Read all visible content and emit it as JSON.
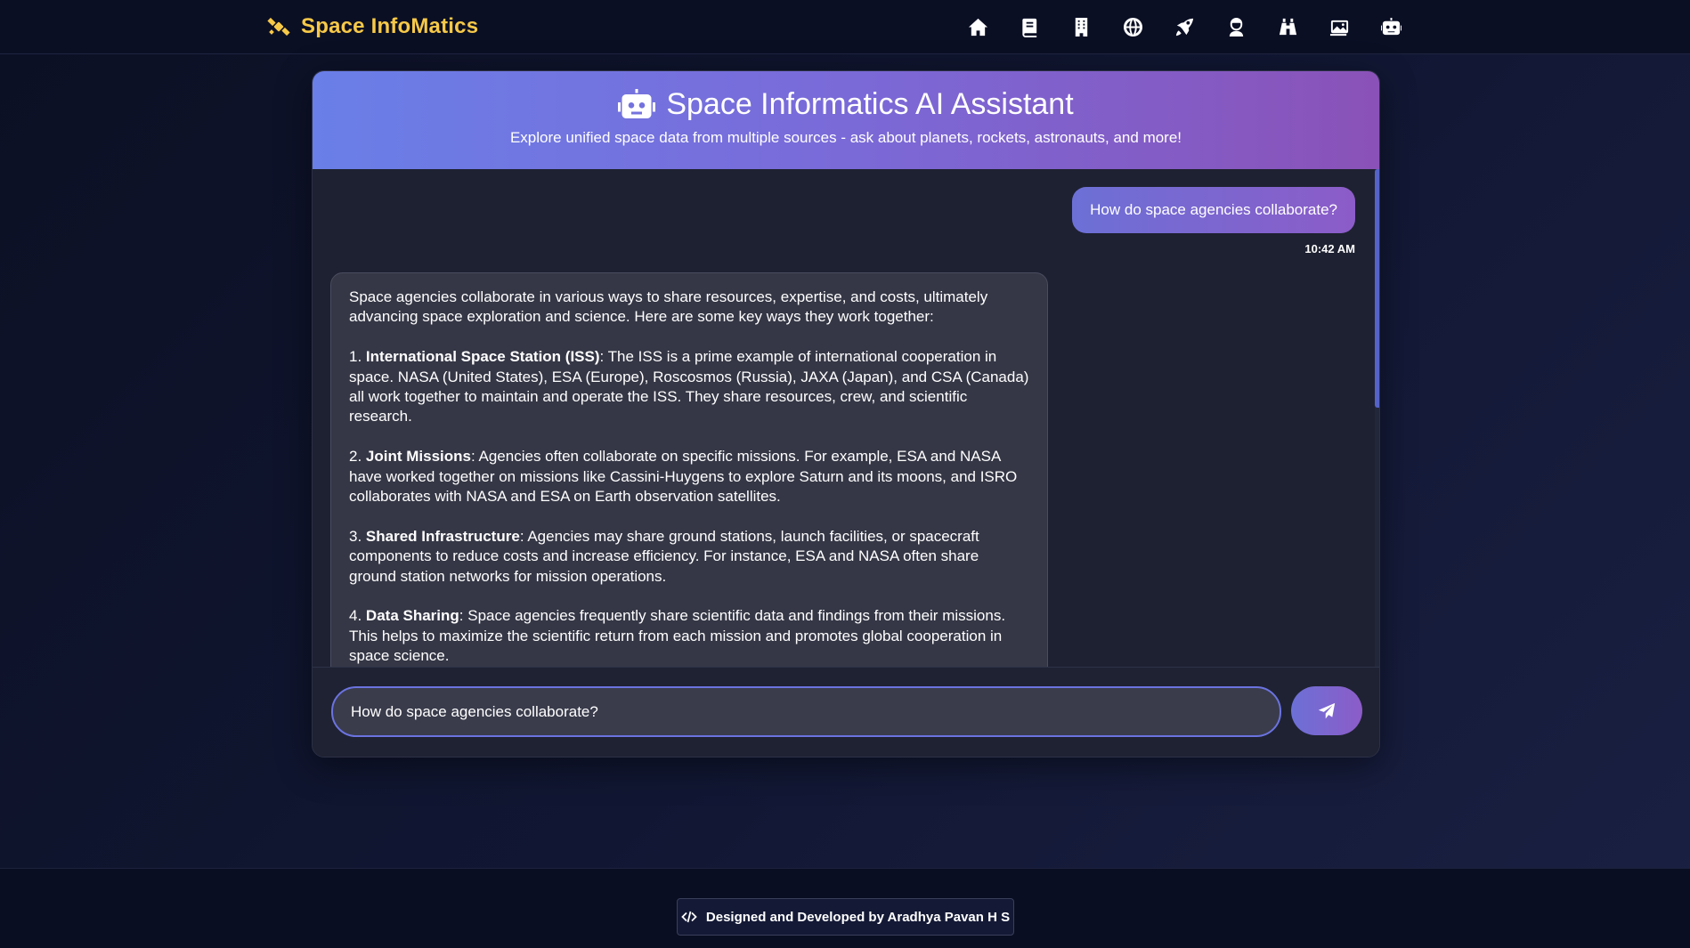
{
  "brand": {
    "name": "Space InfoMatics",
    "icon": "satellite-icon",
    "color": "#f7c948"
  },
  "nav": {
    "items": [
      {
        "name": "home",
        "icon": "home-icon"
      },
      {
        "name": "book",
        "icon": "book-icon"
      },
      {
        "name": "building",
        "icon": "building-icon"
      },
      {
        "name": "globe",
        "icon": "globe-icon"
      },
      {
        "name": "rocket",
        "icon": "rocket-icon"
      },
      {
        "name": "astronaut",
        "icon": "astronaut-icon"
      },
      {
        "name": "binoculars",
        "icon": "binoculars-icon"
      },
      {
        "name": "gallery",
        "icon": "images-icon"
      },
      {
        "name": "ai-assistant",
        "icon": "robot-icon"
      }
    ]
  },
  "chat": {
    "title": "Space Informatics AI Assistant",
    "subtitle": "Explore unified space data from multiple sources - ask about planets, rockets, astronauts, and more!",
    "header_gradient": [
      "#6a7fe8",
      "#8a52b8"
    ],
    "user_message": {
      "text": "How do space agencies collaborate?",
      "time": "10:42 AM"
    },
    "ai_message": {
      "intro": "Space agencies collaborate in various ways to share resources, expertise, and costs, ultimately advancing space exploration and science. Here are some key ways they work together:",
      "points": [
        {
          "num": "1.",
          "title": "International Space Station (ISS)",
          "text": ": The ISS is a prime example of international cooperation in space. NASA (United States), ESA (Europe), Roscosmos (Russia), JAXA (Japan), and CSA (Canada) all work together to maintain and operate the ISS. They share resources, crew, and scientific research."
        },
        {
          "num": "2.",
          "title": "Joint Missions",
          "text": ": Agencies often collaborate on specific missions. For example, ESA and NASA have worked together on missions like Cassini-Huygens to explore Saturn and its moons, and ISRO collaborates with NASA and ESA on Earth observation satellites."
        },
        {
          "num": "3.",
          "title": "Shared Infrastructure",
          "text": ": Agencies may share ground stations, launch facilities, or spacecraft components to reduce costs and increase efficiency. For instance, ESA and NASA often share ground station networks for mission operations."
        },
        {
          "num": "4.",
          "title": "Data Sharing",
          "text": ": Space agencies frequently share scientific data and findings from their missions. This helps to maximize the scientific return from each mission and promotes global cooperation in space science."
        }
      ]
    },
    "input_value": "How do space agencies collaborate?",
    "send_icon": "paper-plane-icon"
  },
  "footer": {
    "text": "Designed and Developed by Aradhya Pavan H S",
    "icon": "code-icon"
  }
}
